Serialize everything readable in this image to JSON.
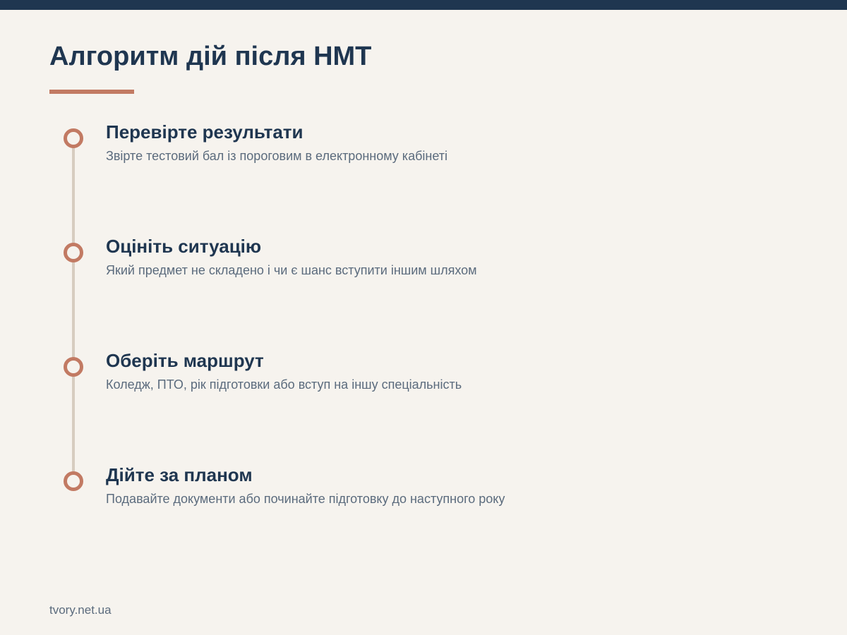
{
  "title": "Алгоритм дій після НМТ",
  "steps": [
    {
      "title": "Перевірте результати",
      "description": "Звірте тестовий бал із пороговим в електронному кабінеті"
    },
    {
      "title": "Оцініть ситуацію",
      "description": "Який предмет не складено і чи є шанс вступити іншим шляхом"
    },
    {
      "title": "Оберіть маршрут",
      "description": "Коледж, ПТО, рік підготовки або вступ на іншу спеціальність"
    },
    {
      "title": "Дійте за планом",
      "description": "Подавайте документи або починайте підготовку до наступного року"
    }
  ],
  "footer": {
    "site": "tvory.net.ua"
  },
  "colors": {
    "primary": "#1f3650",
    "accent": "#c27a63",
    "muted": "#5b6b7d",
    "line": "#d7ccc0",
    "background": "#f6f3ee"
  }
}
